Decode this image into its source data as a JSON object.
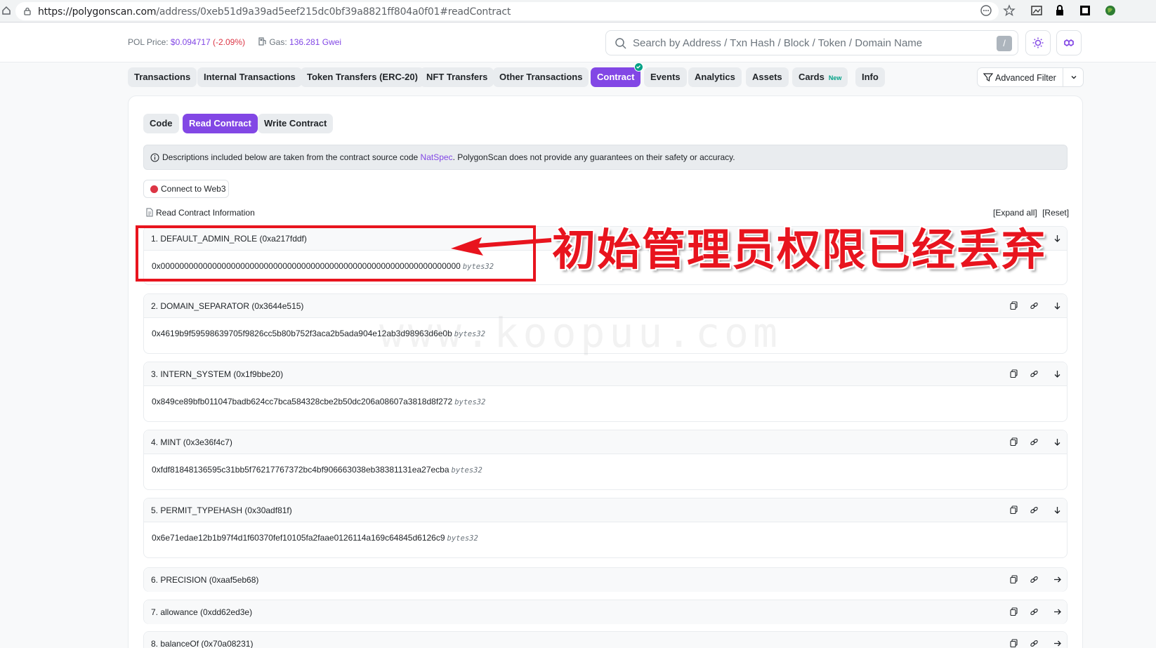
{
  "browser": {
    "url_host": "https://polygonscan.com",
    "url_path": "/address/0xeb51d9a39ad5eef215dc0bf39a8821ff804a0f01#readContract"
  },
  "header": {
    "price_label": "POL Price:",
    "price_value": "$0.094717",
    "price_change": "(-2.09%)",
    "gas_label": "Gas:",
    "gas_value": "136.281 Gwei",
    "search_placeholder": "Search by Address / Txn Hash / Block / Token / Domain Name",
    "search_shortcut": "/"
  },
  "tabs": [
    {
      "label": "Transactions"
    },
    {
      "label": "Internal Transactions"
    },
    {
      "label": "Token Transfers (ERC-20)"
    },
    {
      "label": "NFT Transfers"
    },
    {
      "label": "Other Transactions"
    },
    {
      "label": "Contract"
    },
    {
      "label": "Events"
    },
    {
      "label": "Analytics"
    },
    {
      "label": "Assets"
    },
    {
      "label": "Cards",
      "badge": "New"
    },
    {
      "label": "Info"
    }
  ],
  "advanced_filter_label": "Advanced Filter",
  "subtabs": [
    {
      "label": "Code"
    },
    {
      "label": "Read Contract"
    },
    {
      "label": "Write Contract"
    }
  ],
  "notice": {
    "text_before": "Descriptions included below are taken from the contract source code ",
    "link": "NatSpec",
    "text_after": ". PolygonScan does not provide any guarantees on their safety or accuracy."
  },
  "connect_label": "Connect to Web3",
  "read_info_label": "Read Contract Information",
  "expand_all": "[Expand all]",
  "reset": "[Reset]",
  "functions": [
    {
      "title": "1. DEFAULT_ADMIN_ROLE (0xa217fddf)",
      "value": "0x0000000000000000000000000000000000000000000000000000000000000000",
      "type": "bytes32"
    },
    {
      "title": "2. DOMAIN_SEPARATOR (0x3644e515)",
      "value": "0x4619b9f59598639705f9826cc5b80b752f3aca2b5ada904e12ab3d98963d6e0b",
      "type": "bytes32"
    },
    {
      "title": "3. INTERN_SYSTEM (0x1f9bbe20)",
      "value": "0x849ce89bfb011047badb624cc7bca584328cbe2b50dc206a08607a3818d8f272",
      "type": "bytes32"
    },
    {
      "title": "4. MINT (0x3e36f4c7)",
      "value": "0xfdf81848136595c31bb5f76217767372bc4bf906663038eb38381131ea27ecba",
      "type": "bytes32"
    },
    {
      "title": "5. PERMIT_TYPEHASH (0x30adf81f)",
      "value": "0x6e71edae12b1b97f4d1f60370fef10105fa2faae0126114a169c64845d6126c9",
      "type": "bytes32"
    },
    {
      "title": "6. PRECISION (0xaaf5eb68)"
    },
    {
      "title": "7. allowance (0xdd62ed3e)"
    },
    {
      "title": "8. balanceOf (0x70a08231)"
    }
  ],
  "annotation_text": "初始管理员权限已经丢弃",
  "watermark": "www.koopuu.com",
  "colors": {
    "accent": "#8247e5",
    "annotation": "#e8141e",
    "success": "#00a186",
    "negative": "#dc3545"
  }
}
